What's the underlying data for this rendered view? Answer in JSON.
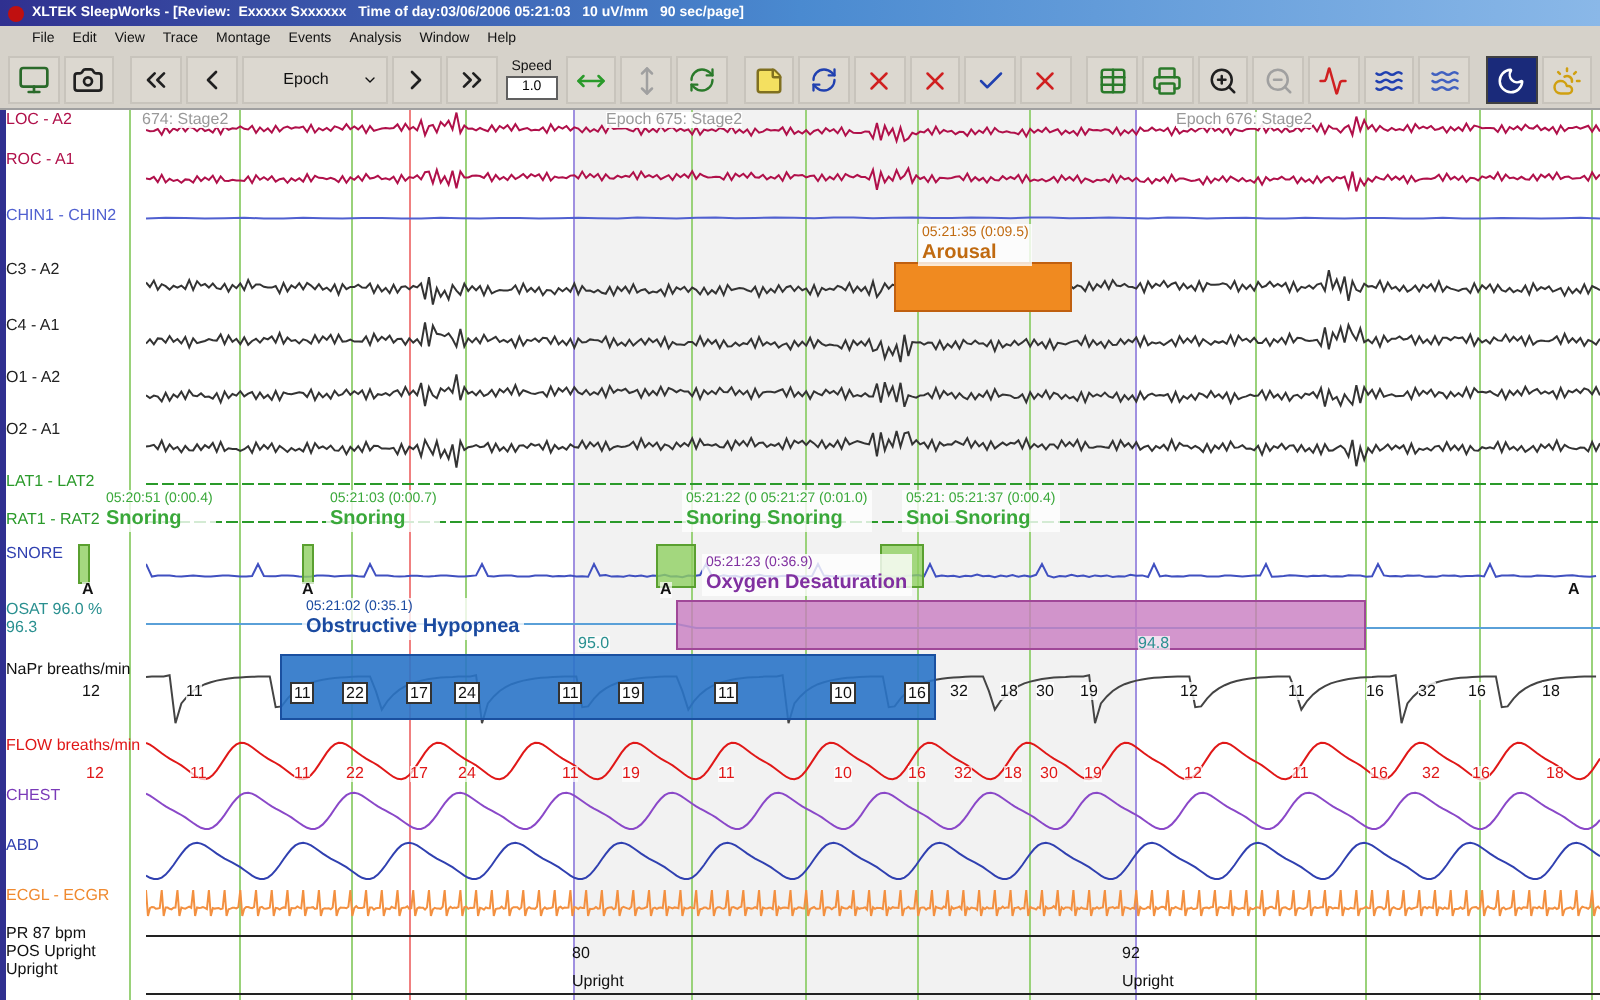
{
  "window": {
    "title": "XLTEK SleepWorks - [Review:  Exxxxx Sxxxxxx   Time of day:03/06/2006 05:21:03   10 uV/mm   90 sec/page]"
  },
  "menu": [
    "File",
    "Edit",
    "View",
    "Trace",
    "Montage",
    "Events",
    "Analysis",
    "Window",
    "Help"
  ],
  "toolbar": {
    "epoch_select": "Epoch",
    "speed_label": "Speed",
    "speed_value": "1.0",
    "moon_pressed": true
  },
  "epochs": [
    "674: Stage2",
    "Epoch 675: Stage2",
    "Epoch 676: Stage2"
  ],
  "channels": [
    {
      "label": "LOC - A2",
      "kind": "eog"
    },
    {
      "label": "ROC - A1",
      "kind": "eog"
    },
    {
      "label": "CHIN1 - CHIN2",
      "kind": "chin"
    },
    {
      "label": "C3 - A2",
      "kind": "eeg"
    },
    {
      "label": "C4 - A1",
      "kind": "eeg"
    },
    {
      "label": "O1 - A2",
      "kind": "eeg"
    },
    {
      "label": "O2 - A1",
      "kind": "eeg"
    },
    {
      "label": "LAT1 - LAT2",
      "kind": "leg"
    },
    {
      "label": "RAT1 - RAT2",
      "kind": "leg"
    },
    {
      "label": "SNORE",
      "kind": "snore"
    },
    {
      "label": "OSAT 96.0 %",
      "sublabel": "96.3",
      "kind": "sat"
    },
    {
      "label": "NaPr breaths/min",
      "kind": "rate"
    },
    {
      "label": "FLOW breaths/min",
      "kind": "flow"
    },
    {
      "label": "CHEST",
      "kind": "chest"
    },
    {
      "label": "ABD",
      "kind": "abd"
    },
    {
      "label": "ECGL - ECGR",
      "kind": "ecg"
    },
    {
      "label": "PR  87 bpm",
      "kind": "status"
    },
    {
      "label": "POS Upright",
      "sublabel": "Upright",
      "kind": "status"
    }
  ],
  "events": [
    {
      "kind": "arousal",
      "time": "05:21:35 (0:09.5)",
      "label": "Arousal"
    },
    {
      "kind": "snoring",
      "time": "05:20:51 (0:00.4)",
      "label": "Snoring"
    },
    {
      "kind": "snoring",
      "time": "05:21:03 (0:00.7)",
      "label": "Snoring"
    },
    {
      "kind": "snoring",
      "time": "05:21:22 (0 05:21:27 (0:01.0)",
      "label": "Snoring Snoring"
    },
    {
      "kind": "snoring",
      "time": "05:21: 05:21:37 (0:00.4)",
      "label": "Snoi Snoring"
    },
    {
      "kind": "desaturation",
      "time": "05:21:23 (0:36.9)",
      "label": "Oxygen Desaturation"
    },
    {
      "kind": "hypopnea",
      "time": "05:21:02 (0:35.1)",
      "label": "Obstructive Hypopnea"
    }
  ],
  "snore_marks": [
    "A",
    "A",
    "A",
    "A"
  ],
  "sat_readings": [
    "95.0",
    "94.8"
  ],
  "rate_values": [
    {
      "text": "12",
      "boxed": false
    },
    {
      "text": "11",
      "boxed": false
    },
    {
      "text": "11",
      "boxed": true
    },
    {
      "text": "22",
      "boxed": true
    },
    {
      "text": "17",
      "boxed": true
    },
    {
      "text": "24",
      "boxed": true
    },
    {
      "text": "11",
      "boxed": true
    },
    {
      "text": "19",
      "boxed": true
    },
    {
      "text": "11",
      "boxed": true
    },
    {
      "text": "10",
      "boxed": true
    },
    {
      "text": "16",
      "boxed": true
    },
    {
      "text": "32",
      "boxed": false
    },
    {
      "text": "18",
      "boxed": false
    },
    {
      "text": "30",
      "boxed": false
    },
    {
      "text": "19",
      "boxed": false
    },
    {
      "text": "12",
      "boxed": false
    },
    {
      "text": "11",
      "boxed": false
    },
    {
      "text": "16",
      "boxed": false
    },
    {
      "text": "32",
      "boxed": false
    },
    {
      "text": "16",
      "boxed": false
    },
    {
      "text": "18",
      "boxed": false
    }
  ],
  "flow_values": [
    "12",
    "11",
    "11",
    "22",
    "17",
    "24",
    "11",
    "19",
    "11",
    "10",
    "16",
    "32",
    "18",
    "30",
    "19",
    "12",
    "11",
    "16",
    "32",
    "16",
    "18"
  ],
  "position_marks": [
    {
      "value": "80",
      "position": "Upright"
    },
    {
      "value": "92",
      "position": "Upright"
    }
  ]
}
